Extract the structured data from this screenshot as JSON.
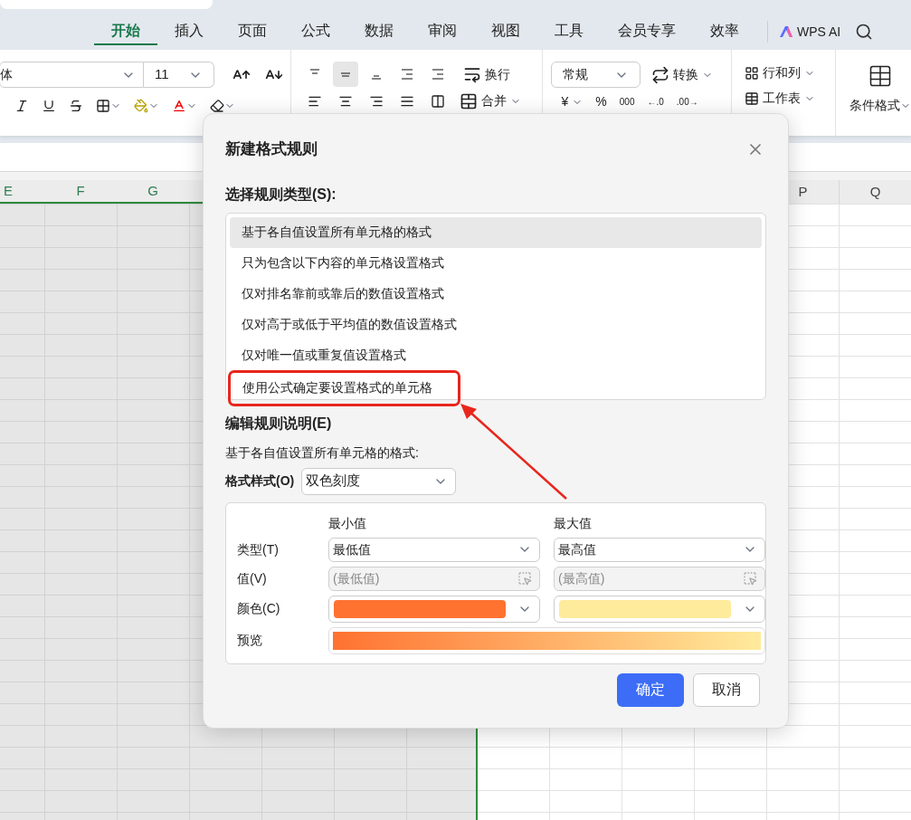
{
  "ribbon_tabs": [
    {
      "label": "开始",
      "selected": true
    },
    {
      "label": "插入",
      "selected": false
    },
    {
      "label": "页面",
      "selected": false
    },
    {
      "label": "公式",
      "selected": false
    },
    {
      "label": "数据",
      "selected": false
    },
    {
      "label": "审阅",
      "selected": false
    },
    {
      "label": "视图",
      "selected": false
    },
    {
      "label": "工具",
      "selected": false
    },
    {
      "label": "会员专享",
      "selected": false
    },
    {
      "label": "效率",
      "selected": false
    }
  ],
  "ai_button": "WPS AI",
  "toolbar": {
    "font_name": "体",
    "font_size": "11",
    "wrap": "换行",
    "merge": "合并",
    "number_format": "常规",
    "convert": "转换",
    "rows_cols": "行和列",
    "worksheet": "工作表",
    "conditional_format": "条件格式",
    "currency": "¥",
    "percent": "%",
    "thousands": "000",
    "decimal_increase": "←.0",
    "decimal_decrease": ".00→"
  },
  "columns": [
    {
      "letter": "E",
      "selected": true
    },
    {
      "letter": "F",
      "selected": true
    },
    {
      "letter": "G",
      "selected": true
    },
    {
      "letter": "P",
      "selected": false
    },
    {
      "letter": "Q",
      "selected": false
    }
  ],
  "dialog": {
    "title": "新建格式规则",
    "rule_type_label": "选择规则类型(S):",
    "rule_types": [
      {
        "label": "基于各自值设置所有单元格的格式",
        "selected": true,
        "highlighted": false
      },
      {
        "label": "只为包含以下内容的单元格设置格式",
        "selected": false,
        "highlighted": false
      },
      {
        "label": "仅对排名靠前或靠后的数值设置格式",
        "selected": false,
        "highlighted": false
      },
      {
        "label": "仅对高于或低于平均值的数值设置格式",
        "selected": false,
        "highlighted": false
      },
      {
        "label": "仅对唯一值或重复值设置格式",
        "selected": false,
        "highlighted": false
      },
      {
        "label": "使用公式确定要设置格式的单元格",
        "selected": false,
        "highlighted": true
      }
    ],
    "edit_label": "编辑规则说明(E)",
    "description": "基于各自值设置所有单元格的格式:",
    "style_label": "格式样式(O)",
    "style_value": "双色刻度",
    "type_label": "类型(T)",
    "value_label": "值(V)",
    "color_label": "颜色(C)",
    "scale_points": [
      {
        "header": "最小值",
        "type": "最低值",
        "value": "(最低值)",
        "color": "#ff7230"
      },
      {
        "header": "最大值",
        "type": "最高值",
        "value": "(最高值)",
        "color": "#ffeb9c"
      }
    ],
    "preview_label": "预览",
    "ok": "确定",
    "cancel": "取消"
  }
}
